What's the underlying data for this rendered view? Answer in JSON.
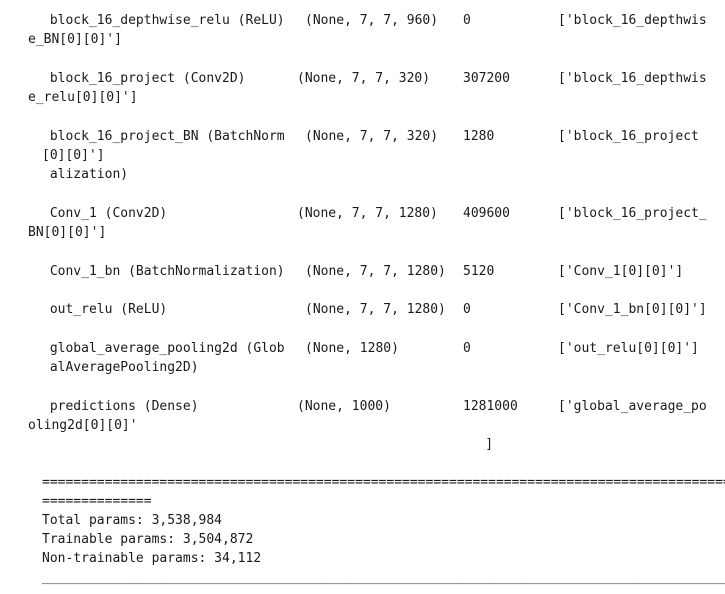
{
  "rows": [
    {
      "layer": " block_16_depthwise_relu (ReLU)",
      "shape": "(None, 7, 7, 960)",
      "params": "0",
      "connected": "['block_16_depthwis",
      "cont": [
        "e_BN[0][0]']"
      ]
    },
    {
      "layer": " block_16_project (Conv2D)",
      "shape": "(None, 7, 7, 320)",
      "params": "307200",
      "connected": "['block_16_depthwis",
      "cont": [
        "e_relu[0][0]']"
      ]
    },
    {
      "layer": " block_16_project_BN (BatchNorm",
      "shape": "(None, 7, 7, 320)",
      "params": "1280",
      "connected": "['block_16_project",
      "cont": [
        "[0][0]']",
        " alization)"
      ]
    },
    {
      "layer": " Conv_1 (Conv2D)",
      "shape": "(None, 7, 7, 1280)",
      "params": "409600",
      "connected": "['block_16_project_",
      "cont": [
        "BN[0][0]']"
      ]
    },
    {
      "layer": " Conv_1_bn (BatchNormalization)",
      "shape": "(None, 7, 7, 1280)",
      "params": "5120",
      "connected": "['Conv_1[0][0]']",
      "cont": []
    },
    {
      "layer": " out_relu (ReLU)",
      "shape": "(None, 7, 7, 1280)",
      "params": "0",
      "connected": "['Conv_1_bn[0][0]']",
      "cont": []
    },
    {
      "layer": " global_average_pooling2d (Glob",
      "shape": "(None, 1280)",
      "params": "0",
      "connected": "['out_relu[0][0]']",
      "cont": [
        " alAveragePooling2D)"
      ]
    },
    {
      "layer": " predictions (Dense)",
      "shape": "(None, 1000)",
      "params": "1281000",
      "connected": "['global_average_po",
      "cont": [
        "oling2d[0][0]'",
        "",
        "                                                              ]"
      ]
    }
  ],
  "summary": {
    "rule_double": "====================================================================================================",
    "rule_double_wrap": "==============",
    "total": "Total params: 3,538,984",
    "trainable": "Trainable params: 3,504,872",
    "non_trainable": "Non-trainable params: 34,112",
    "rule_single": "____________________________________________________________________________________________________"
  }
}
